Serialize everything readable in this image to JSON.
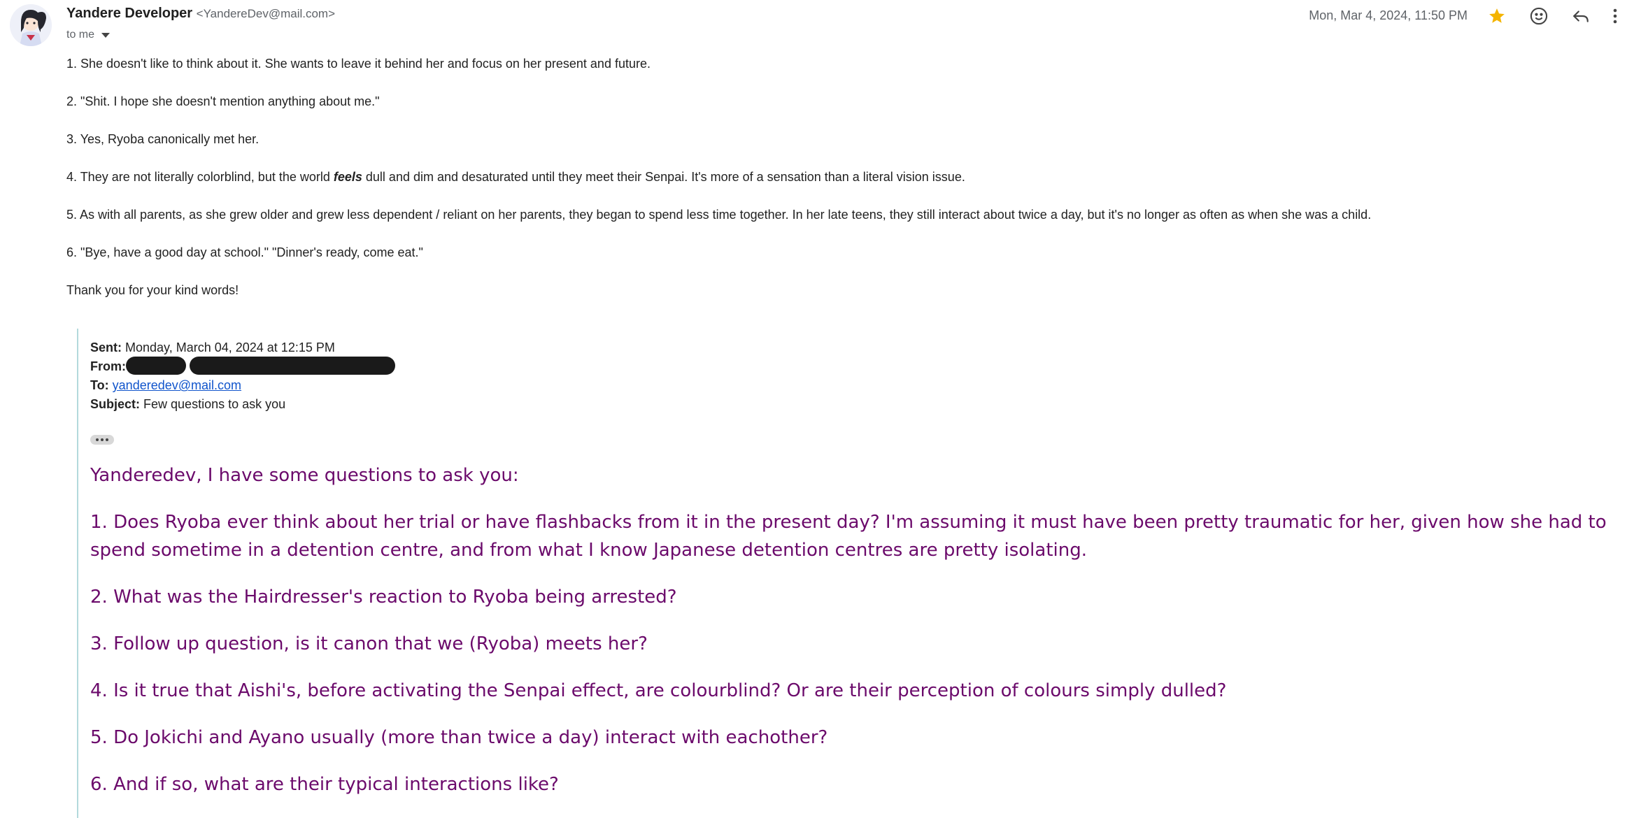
{
  "header": {
    "sender_name": "Yandere Developer",
    "sender_email": "<YandereDev@mail.com>",
    "recipient_label": "to me",
    "date": "Mon, Mar 4, 2024, 11:50 PM"
  },
  "icons": {
    "star": "star-icon",
    "emoji": "emoji-reaction-icon",
    "reply": "reply-icon",
    "more": "more-options-icon",
    "dropdown": "chevron-down-icon"
  },
  "colors": {
    "star": "#f4b400",
    "quote_text": "#6b0a6b",
    "quote_border": "#b3d9dc",
    "link": "#1155cc"
  },
  "reply": {
    "p1": "1. She doesn't like to think about it. She wants to leave it behind her and focus on her present and future.",
    "p2": "2. \"Shit. I hope she doesn't mention anything about me.\"",
    "p3": "3. Yes, Ryoba canonically met her.",
    "p4_before": "4. They are not literally colorblind, but the world ",
    "p4_emph": "feels",
    "p4_after": " dull and dim and desaturated until they meet their Senpai. It's more of a sensation than a literal vision issue.",
    "p5": "5. As with all parents, as she grew older and grew less dependent / reliant on her parents, they began to spend less time together. In her late teens, they still interact about twice a day, but it's no longer as often as when she was a child.",
    "p6": "6. \"Bye, have a good day at school.\" \"Dinner's ready, come eat.\"",
    "p7": "Thank you for your kind words!"
  },
  "quoted": {
    "sent_label": "Sent:",
    "sent_value": "Monday, March 04, 2024 at 12:15 PM",
    "from_label": "From:",
    "to_label": "To:",
    "to_value": "yanderedev@mail.com",
    "subject_label": "Subject:",
    "subject_value": "Few questions to ask you",
    "greeting": "Yanderedev, I have some questions to ask you:",
    "q1": "1. Does Ryoba ever think about her trial or have flashbacks from it in the present day? I'm assuming it must have been pretty traumatic for her, given how she had to spend sometime in a detention centre, and from what I know Japanese detention centres are pretty isolating.",
    "q2": "2. What was the Hairdresser's reaction to Ryoba being arrested?",
    "q3": "3. Follow up question, is it canon that we (Ryoba) meets her?",
    "q4": "4. Is it true that Aishi's, before activating the Senpai effect, are colourblind? Or are their perception of colours simply dulled?",
    "q5": "5. Do Jokichi and Ayano usually (more than twice a day) interact with eachother?",
    "q6": "6. And if so, what are their typical interactions like?"
  }
}
